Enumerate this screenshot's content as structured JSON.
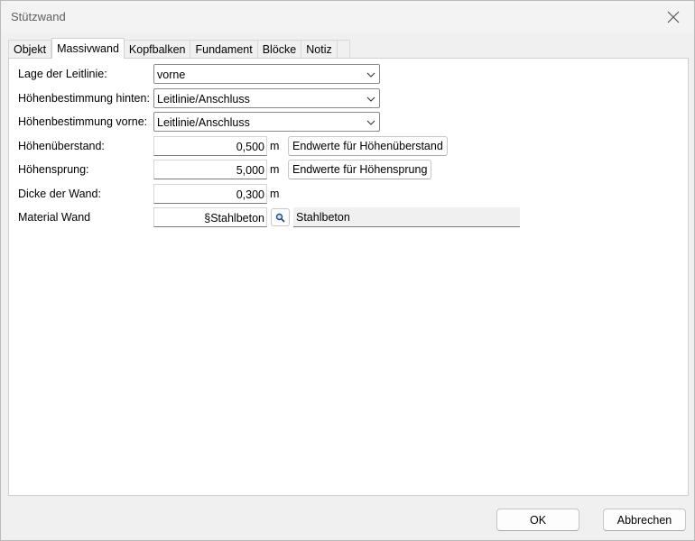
{
  "window": {
    "title": "Stützwand"
  },
  "tabs": [
    {
      "label": "Objekt",
      "active": false
    },
    {
      "label": "Massivwand",
      "active": true
    },
    {
      "label": "Kopfbalken",
      "active": false
    },
    {
      "label": "Fundament",
      "active": false
    },
    {
      "label": "Blöcke",
      "active": false
    },
    {
      "label": "Notiz",
      "active": false
    }
  ],
  "form": {
    "lage": {
      "label": "Lage der Leitlinie:",
      "value": "vorne"
    },
    "hoehe_hinten": {
      "label": "Höhenbestimmung hinten:",
      "value": "Leitlinie/Anschluss"
    },
    "hoehe_vorne": {
      "label": "Höhenbestimmung vorne:",
      "value": "Leitlinie/Anschluss"
    },
    "hoehenueberstand": {
      "label": "Höhenüberstand:",
      "value": "0,500",
      "unit": "m",
      "button": "Endwerte für Höhenüberstand"
    },
    "hoehensprung": {
      "label": "Höhensprung:",
      "value": "5,000",
      "unit": "m",
      "button": "Endwerte für Höhensprung"
    },
    "dicke": {
      "label": "Dicke der Wand:",
      "value": "0,300",
      "unit": "m"
    },
    "material": {
      "label": "Material Wand",
      "value": "§Stahlbeton",
      "display": "Stahlbeton"
    }
  },
  "footer": {
    "ok_label": "OK",
    "cancel_label": "Abbrechen"
  },
  "icons": {
    "close": "close-icon",
    "chevron": "chevron-down-icon",
    "lookup": "magnifier-icon"
  }
}
